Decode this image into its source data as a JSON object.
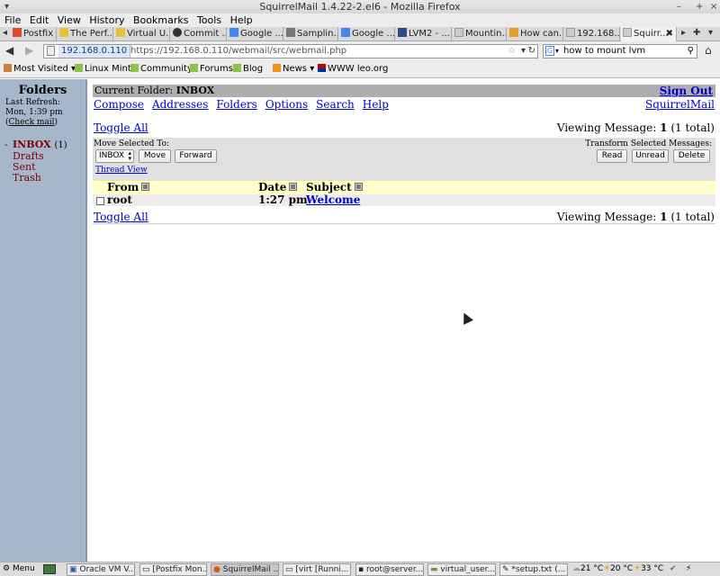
{
  "window": {
    "title": "SquirrelMail 1.4.22-2.el6 - Mozilla Firefox",
    "minimize": "–",
    "maximize": "+",
    "close": "×"
  },
  "menu": [
    "File",
    "Edit",
    "View",
    "History",
    "Bookmarks",
    "Tools",
    "Help"
  ],
  "tabs": [
    {
      "label": "Postfix ...",
      "color": "#d94b2b"
    },
    {
      "label": "The Perf...",
      "color": "#e8c13a"
    },
    {
      "label": "Virtual U...",
      "color": "#e8c13a"
    },
    {
      "label": "Commit ...",
      "color": "#333333"
    },
    {
      "label": "Google ...",
      "color": "#4285f4"
    },
    {
      "label": "Samplin...",
      "color": "#777777"
    },
    {
      "label": "Google ...",
      "color": "#4285f4"
    },
    {
      "label": "LVM2 - ...",
      "color": "#2a4a8a"
    },
    {
      "label": "Mountin...",
      "color": "#aaaaaa"
    },
    {
      "label": "How can...",
      "color": "#e0a020"
    },
    {
      "label": "192.168....",
      "color": "#aaaaaa"
    },
    {
      "label": "Squirr...",
      "color": "#aaaaaa",
      "active": true
    }
  ],
  "nav": {
    "site": "192.168.0.110",
    "url": "https://192.168.0.110/webmail/src/webmail.php",
    "search_value": "how to mount lvm"
  },
  "bookmarks": [
    "Most Visited ▾",
    "Linux Mint",
    "Community",
    "Forums",
    "Blog",
    "News ▾",
    "WWW leo.org"
  ],
  "left": {
    "heading": "Folders",
    "last_refresh_label": "Last Refresh:",
    "last_refresh_value": "Mon, 1:39 pm",
    "check_mail": "Check mail",
    "folders": [
      {
        "name": "INBOX",
        "count": "(1)"
      },
      {
        "name": "Drafts"
      },
      {
        "name": "Sent"
      },
      {
        "name": "Trash"
      }
    ]
  },
  "main": {
    "current_folder_label": "Current Folder:",
    "current_folder": "INBOX",
    "sign_out": "Sign Out",
    "links": [
      "Compose",
      "Addresses",
      "Folders",
      "Options",
      "Search",
      "Help"
    ],
    "squirrelmail": "SquirrelMail",
    "toggle_all": "Toggle All",
    "viewing_prefix": "Viewing Message:",
    "viewing_num": "1",
    "viewing_suffix": "(1 total)",
    "move_selected": "Move Selected To:",
    "move_select_value": "INBOX",
    "move_btn": "Move",
    "forward_btn": "Forward",
    "thread_view": "Thread View",
    "transform_label": "Transform Selected Messages:",
    "read_btn": "Read",
    "unread_btn": "Unread",
    "delete_btn": "Delete",
    "columns": [
      "From",
      "Date",
      "Subject"
    ],
    "messages": [
      {
        "from": "root",
        "date": "1:27 pm",
        "subject": "Welcome"
      }
    ]
  },
  "taskbar": {
    "menu": "Menu",
    "tasks": [
      "Oracle VM V...",
      "[Postfix Mon...",
      "SquirrelMail ...",
      "[virt [Runni...",
      "root@server...",
      "virtual_user...",
      "*setup.txt (..."
    ],
    "temps": [
      "21 °C",
      "20 °C",
      "33 °C"
    ]
  }
}
